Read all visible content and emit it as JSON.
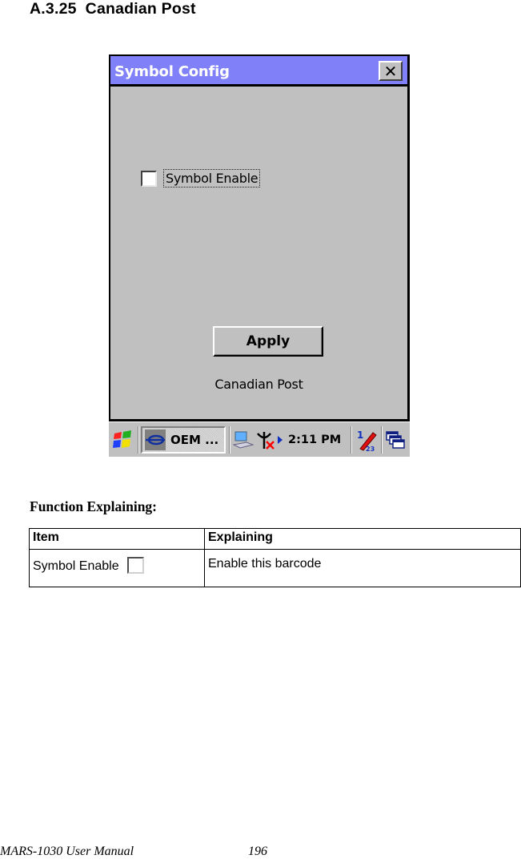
{
  "section": {
    "number": "A.3.25",
    "title": "Canadian Post"
  },
  "device": {
    "window": {
      "title": "Symbol Config",
      "close_icon": "close-icon",
      "checkbox": {
        "label": "Symbol Enable",
        "checked": false
      },
      "apply_label": "Apply",
      "caption": "Canadian Post"
    },
    "taskbar": {
      "start_icon": "windows-start-icon",
      "task_button_label": "OEM ...",
      "tray_icons": [
        "network-icon",
        "signal-off-icon",
        "tray-arrow-icon"
      ],
      "clock": "2:11 PM",
      "input_panel_icon": "input-panel-icon",
      "desktop_icon": "windows-switch-icon"
    },
    "colors": {
      "titlebar": "#8080f8",
      "face": "#c0c0c0"
    }
  },
  "function_heading": "Function Explaining:",
  "table": {
    "headers": [
      "Item",
      "Explaining"
    ],
    "rows": [
      {
        "item": "Symbol Enable",
        "explaining": "Enable this barcode"
      }
    ]
  },
  "footer": {
    "manual": "MARS-1030 User Manual",
    "page": "196"
  }
}
